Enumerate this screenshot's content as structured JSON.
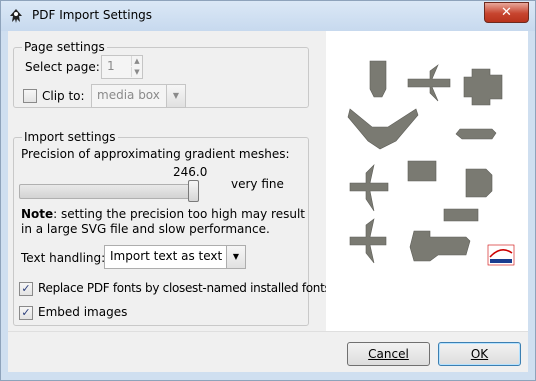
{
  "window": {
    "title": "PDF Import Settings",
    "close_glyph": "✕"
  },
  "page_settings": {
    "legend": "Page settings",
    "select_page_label": "Select page:",
    "select_page_value": "1",
    "clip_to_label": "Clip to:",
    "clip_to_checked": false,
    "clip_to_value": "media box"
  },
  "import_settings": {
    "legend": "Import settings",
    "precision_label": "Precision of approximating gradient meshes:",
    "precision_value": "246.0",
    "precision_fraction": 0.985,
    "precision_desc": "very fine",
    "note_bold": "Note",
    "note_text": ": setting the precision too high may result in a large SVG file and slow performance.",
    "text_handling_label": "Text handling:",
    "text_handling_value": "Import text as text",
    "replace_fonts_label": "Replace PDF fonts by closest-named installed fonts",
    "replace_fonts_checked": true,
    "embed_images_label": "Embed images",
    "embed_images_checked": true,
    "check_glyph": "✓"
  },
  "buttons": {
    "cancel_label": "Cancel",
    "ok_label": "OK"
  },
  "icons": {
    "app": "inkscape-icon",
    "close": "close-icon",
    "dropdown": "chevron-down-icon"
  }
}
